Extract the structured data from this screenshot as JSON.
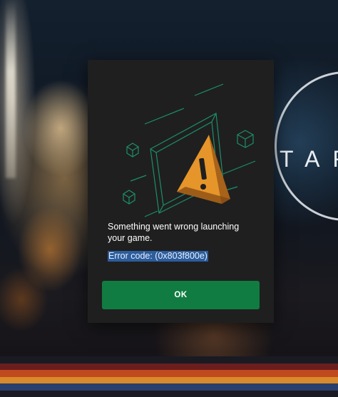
{
  "background": {
    "logo_text": "TAR"
  },
  "dialog": {
    "illustration_icon": "warning-triangle-icon",
    "message": "Something went wrong launching your game.",
    "error_code": "Error code: (0x803f800e)",
    "ok_label": "OK"
  },
  "colors": {
    "dialog_bg": "#1f1f1f",
    "accent_green": "#107c41",
    "selection_blue": "#2c5d9c",
    "warning_orange": "#e6952a",
    "illustration_teal": "#1c8f6a",
    "stripes": [
      "#6b1e1e",
      "#c04a1e",
      "#d98a2a",
      "#2a3f6e",
      "#1a1a22"
    ]
  }
}
